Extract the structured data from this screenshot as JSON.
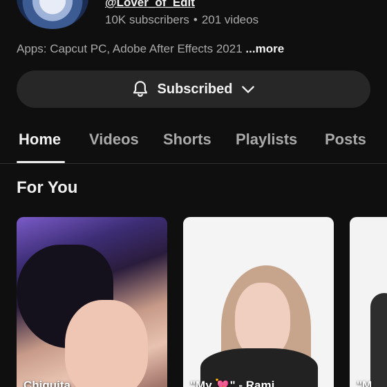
{
  "channel": {
    "handle": "@Lover_of_Edit",
    "subscribers": "10K subscribers",
    "separator": "•",
    "videos": "201 videos",
    "description": "Apps: Capcut PC, Adobe After Effects 2021",
    "more_label": "...more"
  },
  "subscribe_button": {
    "label": "Subscribed",
    "bell_icon": "bell-icon",
    "chevron_icon": "chevron-down-icon"
  },
  "tabs": [
    {
      "label": "Home",
      "active": true
    },
    {
      "label": "Videos",
      "active": false
    },
    {
      "label": "Shorts",
      "active": false
    },
    {
      "label": "Playlists",
      "active": false
    },
    {
      "label": "Posts",
      "active": false
    }
  ],
  "section": {
    "title": "For You"
  },
  "shorts": [
    {
      "title": "Chiquita"
    },
    {
      "title": "\"My 💘\" - Rami"
    },
    {
      "title": "\"M"
    }
  ],
  "colors": {
    "background": "#0f0f0f",
    "button_bg": "#272727",
    "text_primary": "#f1f1f1",
    "text_secondary": "#aaaaaa"
  }
}
